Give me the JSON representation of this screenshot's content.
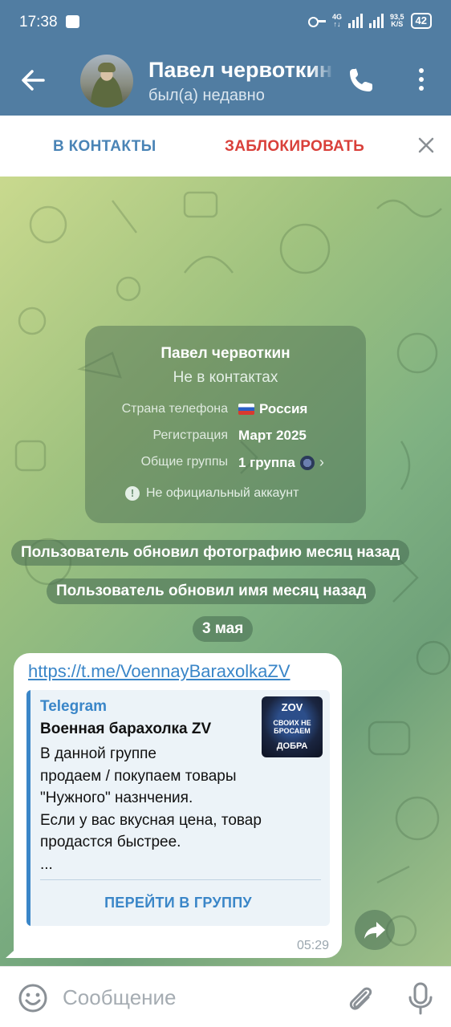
{
  "status_bar": {
    "time": "17:38",
    "net_4g": "4G",
    "speed_value": "93,5",
    "speed_unit": "K/S",
    "battery": "42"
  },
  "header": {
    "contact_name": "Павел червоткин",
    "last_seen": "был(а) недавно"
  },
  "action_bar": {
    "add_contact_label": "В КОНТАКТЫ",
    "block_label": "ЗАБЛОКИРОВАТЬ"
  },
  "info_card": {
    "name": "Павел червоткин",
    "status": "Не в контактах",
    "rows": [
      {
        "label": "Страна телефона",
        "value": "Россия"
      },
      {
        "label": "Регистрация",
        "value": "Март 2025"
      },
      {
        "label": "Общие группы",
        "value": "1 группа"
      }
    ],
    "unofficial": "Не официальный аккаунт"
  },
  "service_messages": [
    "Пользователь обновил фотографию месяц назад",
    "Пользователь обновил имя месяц назад"
  ],
  "date_badge": "3 мая",
  "message": {
    "link": "https://t.me/VoennayBaraxolkaZV",
    "preview": {
      "site": "Telegram",
      "title": "Военная барахолка ZV",
      "description_lines": [
        "В данной группе",
        "продаем / покупаем товары",
        "\"Нужного\" назнчения.",
        "Если у вас вкусная цена, товар",
        "продастся быстрее.",
        "..."
      ],
      "thumb_text": [
        "ZOV",
        "СВОИХ НЕ БРОСАЕМ",
        "ДОБРА"
      ],
      "button": "ПЕРЕЙТИ В ГРУППУ"
    },
    "time": "05:29"
  },
  "input": {
    "placeholder": "Сообщение"
  },
  "colors": {
    "header_bg": "#517da2",
    "link": "#3a86c8",
    "block": "#d9403a",
    "add_contact": "#4a84b6"
  }
}
